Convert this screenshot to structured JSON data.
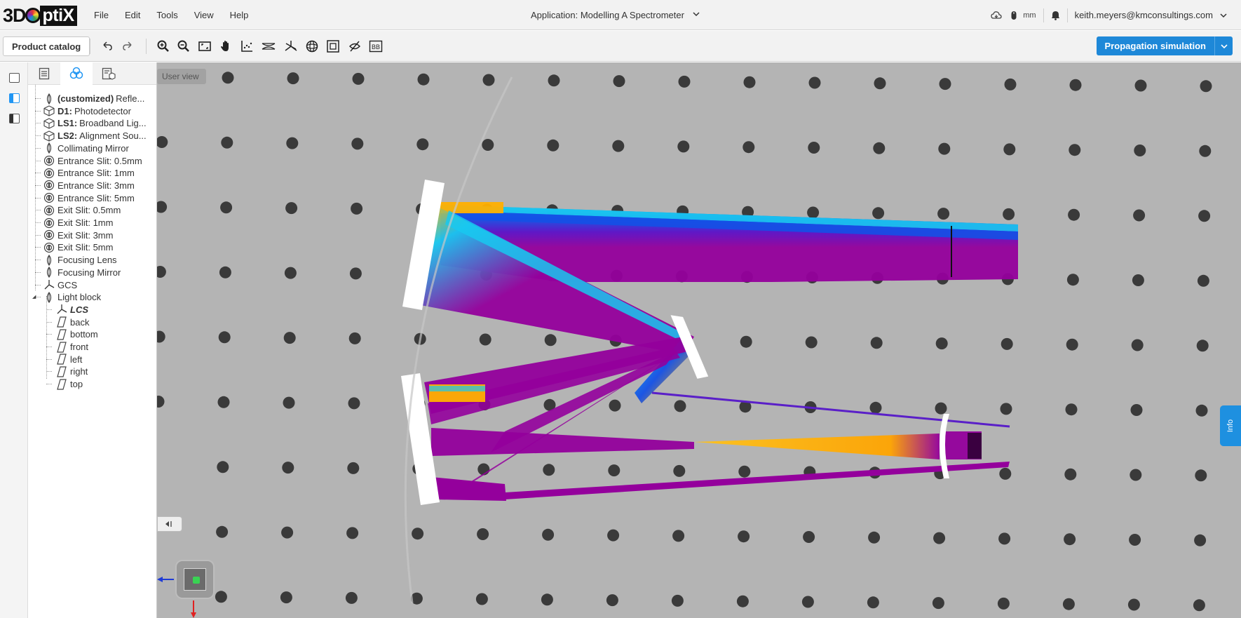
{
  "app": {
    "logo_text": "3DOptiX",
    "title": "Application: Modelling A Spectrometer",
    "user": "keith.meyers@kmconsultings.com",
    "unit": "mm"
  },
  "menu": [
    "File",
    "Edit",
    "Tools",
    "View",
    "Help"
  ],
  "toolbar": {
    "catalog_label": "Product catalog",
    "propagation_label": "Propagation simulation",
    "bb_label": "BB",
    "icons": [
      "undo-icon",
      "redo-icon",
      "zoom-in-icon",
      "zoom-out-icon",
      "fit-view-icon",
      "pan-hand-icon",
      "measure-icon",
      "ray-icon",
      "axes-icon",
      "sphere-icon",
      "frame-icon",
      "hide-icon"
    ]
  },
  "viewport": {
    "label": "User view",
    "info_label": "Info"
  },
  "tree": [
    {
      "bold": "(customized)",
      "label": "Refle...",
      "icon": "lens-icon",
      "depth": 0
    },
    {
      "bold": "D1:",
      "label": "Photodetector",
      "icon": "cube-icon",
      "depth": 0
    },
    {
      "bold": "LS1:",
      "label": "Broadband Lig...",
      "icon": "cube-icon",
      "depth": 0
    },
    {
      "bold": "LS2:",
      "label": "Alignment Sou...",
      "icon": "cube-icon",
      "depth": 0
    },
    {
      "bold": "",
      "label": "Collimating Mirror",
      "icon": "lens-icon",
      "depth": 0
    },
    {
      "bold": "",
      "label": "Entrance Slit: 0.5mm",
      "icon": "slit-icon",
      "depth": 0
    },
    {
      "bold": "",
      "label": "Entrance Slit: 1mm",
      "icon": "slit-icon",
      "depth": 0
    },
    {
      "bold": "",
      "label": "Entrance Slit: 3mm",
      "icon": "slit-icon",
      "depth": 0
    },
    {
      "bold": "",
      "label": "Entrance Slit: 5mm",
      "icon": "slit-icon",
      "depth": 0
    },
    {
      "bold": "",
      "label": "Exit Slit: 0.5mm",
      "icon": "slit-icon",
      "depth": 0
    },
    {
      "bold": "",
      "label": "Exit Slit: 1mm",
      "icon": "slit-icon",
      "depth": 0
    },
    {
      "bold": "",
      "label": "Exit Slit: 3mm",
      "icon": "slit-icon",
      "depth": 0
    },
    {
      "bold": "",
      "label": "Exit Slit: 5mm",
      "icon": "slit-icon",
      "depth": 0
    },
    {
      "bold": "",
      "label": "Focusing Lens",
      "icon": "lens-icon",
      "depth": 0
    },
    {
      "bold": "",
      "label": "Focusing Mirror",
      "icon": "lens-icon",
      "depth": 0
    },
    {
      "bold": "",
      "label": "GCS",
      "icon": "axes-icon",
      "depth": 0
    },
    {
      "bold": "",
      "label": "Light block",
      "icon": "lens-icon",
      "depth": 0
    },
    {
      "bold": "LCS",
      "label": "",
      "icon": "axes-icon",
      "depth": 1
    },
    {
      "bold": "",
      "label": "back",
      "icon": "face-icon",
      "depth": 1
    },
    {
      "bold": "",
      "label": "bottom",
      "icon": "face-icon",
      "depth": 1
    },
    {
      "bold": "",
      "label": "front",
      "icon": "face-icon",
      "depth": 1
    },
    {
      "bold": "",
      "label": "left",
      "icon": "face-icon",
      "depth": 1
    },
    {
      "bold": "",
      "label": "right",
      "icon": "face-icon",
      "depth": 1
    },
    {
      "bold": "",
      "label": "top",
      "icon": "face-icon",
      "depth": 1
    }
  ],
  "colors": {
    "accent": "#1e88d8",
    "viewport_bg": "#b4b4b4",
    "hole": "#3a3a3a",
    "ray_purple": "#94009c",
    "ray_blue": "#1450e6",
    "ray_cyan": "#19c8f0",
    "ray_orange": "#ffb000"
  }
}
